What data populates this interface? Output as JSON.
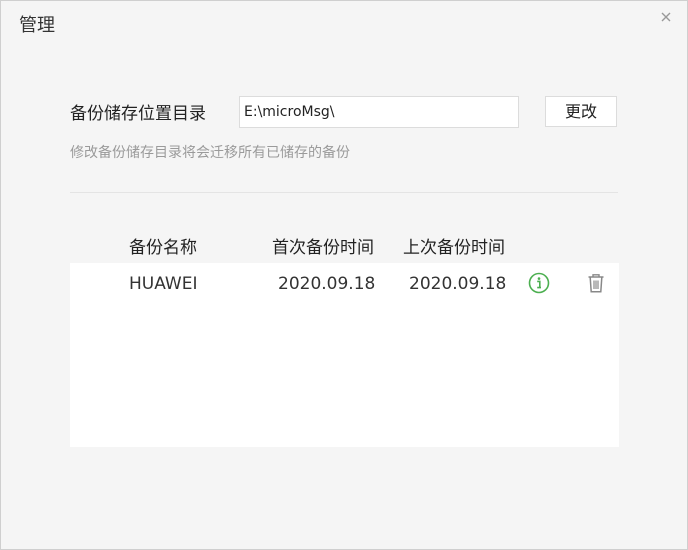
{
  "window": {
    "title": "管理",
    "close_icon": "close-icon"
  },
  "backup_dir": {
    "label": "备份储存位置目录",
    "value": "E:\\microMsg\\",
    "change_button": "更改",
    "hint": "修改备份储存目录将会迁移所有已储存的备份"
  },
  "table": {
    "columns": [
      "备份名称",
      "首次备份时间",
      "上次备份时间"
    ],
    "rows": [
      {
        "name": "HUAWEI",
        "first_backup": "2020.09.18",
        "last_backup": "2020.09.18",
        "info_icon": "info-icon",
        "delete_icon": "trash-icon"
      }
    ]
  },
  "colors": {
    "window_bg": "#f5f5f5",
    "panel_bg": "#ffffff",
    "hint_text": "#9a9a9a",
    "info_green": "#4caf50",
    "trash_gray": "#888888"
  }
}
